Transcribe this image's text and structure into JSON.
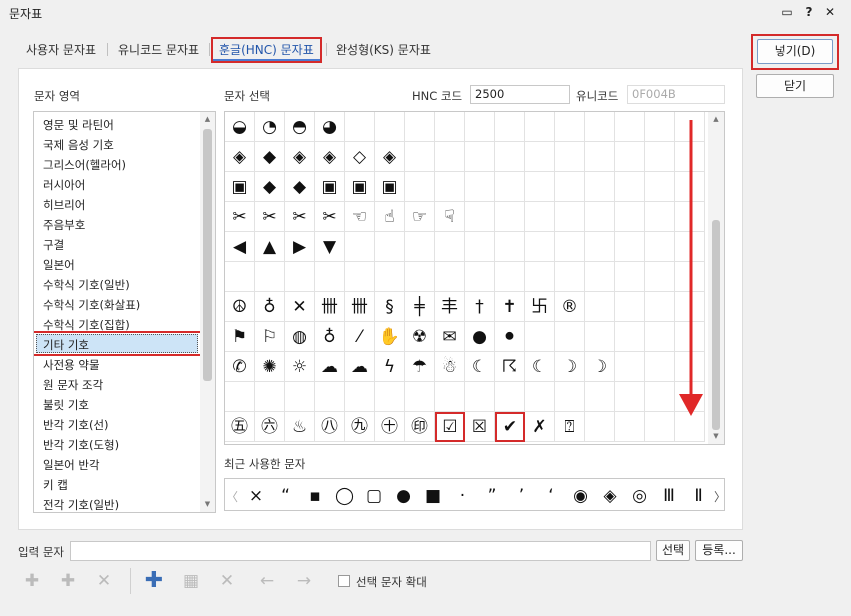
{
  "window": {
    "title": "문자표",
    "controls": [
      "▭",
      "?",
      "✕"
    ]
  },
  "tabs": [
    {
      "label": "사용자 문자표"
    },
    {
      "label": "유니코드 문자표"
    },
    {
      "label": "훈글(HNC) 문자표"
    },
    {
      "label": "완성형(KS) 문자표"
    }
  ],
  "buttons": {
    "insert": "넣기(D)",
    "close": "닫기",
    "select": "선택",
    "register": "등록..."
  },
  "area": {
    "label": "문자 영역",
    "selected_index": 11,
    "items": [
      "영문 및 라틴어",
      "국제 음성 기호",
      "그리스어(헬라어)",
      "러시아어",
      "히브리어",
      "주음부호",
      "구결",
      "일본어",
      "수학식 기호(일반)",
      "수학식 기호(화살표)",
      "수학식 기호(집합)",
      "기타 기호",
      "사전용 약물",
      "원 문자 조각",
      "불릿 기호",
      "반각 기호(선)",
      "반각 기호(도형)",
      "일본어 반각",
      "키 캡",
      "전각 기호(일반)"
    ]
  },
  "select": {
    "label": "문자 선택",
    "hnc_label": "HNC 코드",
    "hnc_value": "2500",
    "unicode_label": "유니코드",
    "unicode_value": "0F004B"
  },
  "grid": {
    "rows": [
      [
        "◒",
        "◔",
        "◓",
        "◕",
        "",
        "",
        "",
        "",
        "",
        "",
        "",
        "",
        "",
        "",
        "",
        ""
      ],
      [
        "◈",
        "◆",
        "◈",
        "◈",
        "◇",
        "◈",
        "",
        "",
        "",
        "",
        "",
        "",
        "",
        "",
        "",
        ""
      ],
      [
        "▣",
        "◆",
        "◆",
        "▣",
        "▣",
        "▣",
        "",
        "",
        "",
        "",
        "",
        "",
        "",
        "",
        "",
        ""
      ],
      [
        "✂",
        "✂",
        "✂",
        "✂",
        "☜",
        "☝",
        "☞",
        "☟",
        "",
        "",
        "",
        "",
        "",
        "",
        "",
        ""
      ],
      [
        "◀",
        "▲",
        "▶",
        "▼",
        "",
        "",
        "",
        "",
        "",
        "",
        "",
        "",
        "",
        "",
        "",
        ""
      ],
      [
        "",
        "",
        "",
        "",
        "",
        "",
        "",
        "",
        "",
        "",
        "",
        "",
        "",
        "",
        "",
        ""
      ],
      [
        "☮",
        "♁",
        "✕",
        "卌",
        "卌",
        "§",
        "╪",
        "丰",
        "†",
        "✝",
        "卐",
        "®",
        "",
        "",
        "",
        ""
      ],
      [
        "⚑",
        "⚐",
        "◍",
        "♁",
        "⁄",
        "✋",
        "☢",
        "✉",
        "●",
        "⚫",
        "",
        "",
        "",
        "",
        "",
        ""
      ],
      [
        "✆",
        "✺",
        "☼",
        "☁",
        "☁",
        "ϟ",
        "☂",
        "☃",
        "☾",
        "☈",
        "☾",
        "☽",
        "☽",
        "",
        "",
        ""
      ],
      [
        "",
        "",
        "",
        "",
        "",
        "",
        "",
        "",
        "",
        "",
        "",
        "",
        "",
        "",
        "",
        ""
      ],
      [
        "㊄",
        "㊅",
        "♨",
        "㊇",
        "㊈",
        "㊉",
        "㊞",
        "☑",
        "☒",
        "✔",
        "✗",
        "⍰",
        "",
        "",
        "",
        ""
      ]
    ],
    "highlighted": [
      "☑",
      "✔"
    ]
  },
  "recent": {
    "label": "최근 사용한 문자",
    "chars": [
      "×",
      "“",
      "▪",
      "◯",
      "▢",
      "●",
      "■",
      "·",
      "”",
      "’",
      "‘",
      "◉",
      "◈",
      "◎",
      "Ⅲ",
      "Ⅱ"
    ]
  },
  "input": {
    "label": "입력 문자",
    "value": ""
  },
  "toolbar": {
    "icons": [
      "✚",
      "✚",
      "✕",
      "✚",
      "▦",
      "✕",
      "←",
      "→"
    ]
  },
  "option": {
    "enlarge_label": "선택 문자 확대",
    "checked": false
  },
  "colors": {
    "accent": "#d42a2a",
    "selected_bg": "#cde4f7"
  }
}
